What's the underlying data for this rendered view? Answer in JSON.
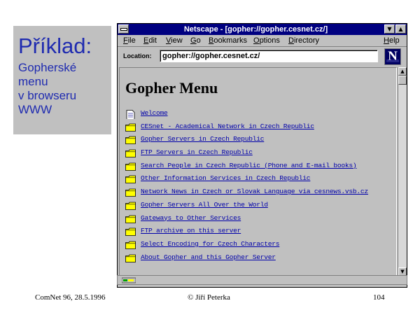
{
  "slide": {
    "title": "Příklad:",
    "subtitle": "Gopherské\nmenu\nv browseru\nWWW",
    "footer_left": "ComNet 96, 28.5.1996",
    "footer_center": "© Jiří Peterka",
    "footer_right": "104"
  },
  "window": {
    "title": "Netscape - [gopher://gopher.cesnet.cz/]",
    "minimize_glyph": "▼",
    "maximize_glyph": "▲"
  },
  "menubar": [
    "File",
    "Edit",
    "View",
    "Go",
    "Bookmarks",
    "Options",
    "Directory",
    "Help"
  ],
  "location": {
    "label": "Location:",
    "value": "gopher://gopher.cesnet.cz/"
  },
  "logo": {
    "letter": "N"
  },
  "page": {
    "heading": "Gopher Menu",
    "items": [
      {
        "icon": "document-icon",
        "label": "Welcome"
      },
      {
        "icon": "folder-icon",
        "label": "CESnet - Academical Network in Czech Republic"
      },
      {
        "icon": "folder-icon",
        "label": "Gopher Servers in Czech Republic"
      },
      {
        "icon": "folder-icon",
        "label": "FTP Servers in Czech Republic"
      },
      {
        "icon": "folder-icon",
        "label": "Search People in Czech Republic (Phone and E-mail books)"
      },
      {
        "icon": "folder-icon",
        "label": "Other Information Services in Czech Republic"
      },
      {
        "icon": "folder-icon",
        "label": "Network News in Czech or Slovak Language via cesnews.vsb.cz"
      },
      {
        "icon": "folder-icon",
        "label": "Gopher Servers All Over the World"
      },
      {
        "icon": "folder-icon",
        "label": "Gateways to Other Services"
      },
      {
        "icon": "folder-icon",
        "label": "FTP archive on this server"
      },
      {
        "icon": "folder-icon",
        "label": "Select Encoding for Czech Characters"
      },
      {
        "icon": "folder-icon",
        "label": "About Gopher and this Gopher Server"
      }
    ]
  },
  "scroll": {
    "up_glyph": "▲",
    "down_glyph": "▼",
    "left_glyph": "◀",
    "right_glyph": "▶"
  },
  "colors": {
    "title_text": "#1f2bb0",
    "titlebar": "#000080",
    "link": "#0000aa",
    "folder": "#ffff00",
    "chrome": "#c0c0c0"
  }
}
